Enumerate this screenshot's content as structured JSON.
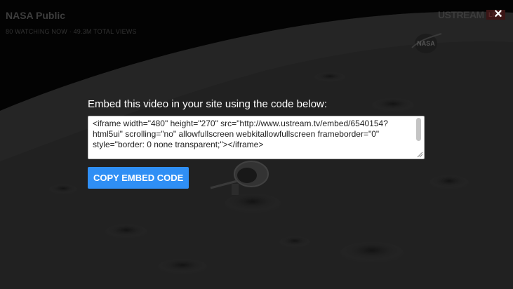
{
  "channel": {
    "title": "NASA Public",
    "stats": "80 WATCHING NOW · 49.3M TOTAL VIEWS"
  },
  "branding": {
    "ustream_logo_text": "USTREAM",
    "live_badge": "LIVE",
    "nasa_logo_text": "NASA"
  },
  "close_button": {
    "label": "×"
  },
  "embed": {
    "heading": "Embed this video in your site using the code below:",
    "code": "<iframe width=\"480\" height=\"270\" src=\"http://www.ustream.tv/embed/6540154?html5ui\" scrolling=\"no\" allowfullscreen webkitallowfullscreen frameborder=\"0\" style=\"border: 0 none transparent;\"></iframe>",
    "copy_button_label": "COPY EMBED CODE"
  },
  "colors": {
    "accent_button": "#2f8ff5",
    "overlay_text": "#ffffff"
  }
}
